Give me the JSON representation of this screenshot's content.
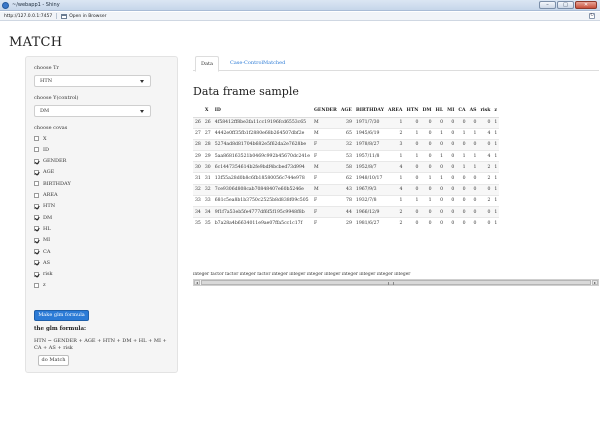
{
  "window": {
    "title": "~/webapp1 - Shiny",
    "buttons": [
      "–",
      "□",
      "✕"
    ]
  },
  "addressbar": {
    "url": "http://127.0.0.1:7457",
    "open_label": "Open in Browser",
    "refresh_glyph": "↻"
  },
  "app": {
    "title": "MATCH"
  },
  "sidebar": {
    "tr_label": "choose Tr",
    "tr_value": "HTN",
    "y_label": "choose Y(control)",
    "y_value": "DM",
    "covas_label": "choose covas",
    "covas": [
      {
        "label": "X",
        "checked": false
      },
      {
        "label": "ID",
        "checked": false
      },
      {
        "label": "GENDER",
        "checked": true
      },
      {
        "label": "AGE",
        "checked": true
      },
      {
        "label": "BIRTHDAY",
        "checked": false
      },
      {
        "label": "AREA",
        "checked": false
      },
      {
        "label": "HTN",
        "checked": true
      },
      {
        "label": "DM",
        "checked": true
      },
      {
        "label": "HL",
        "checked": true
      },
      {
        "label": "MI",
        "checked": true
      },
      {
        "label": "CA",
        "checked": true
      },
      {
        "label": "AS",
        "checked": true
      },
      {
        "label": "risk",
        "checked": true
      },
      {
        "label": "z",
        "checked": false
      }
    ],
    "make_button": "Make glm formula",
    "glm_title": "the glm formula:",
    "glm_formula": "HTN ~ GENDER + AGE + HTN + DM + HL + MI + CA + AS + risk",
    "match_button": "do Match"
  },
  "tabs": [
    "Data",
    "Case-Control",
    "Matched"
  ],
  "main": {
    "section_title": "Data frame sample",
    "columns": [
      "",
      "X",
      "ID",
      "GENDER",
      "AGE",
      "BIRTHDAY",
      "AREA",
      "HTN",
      "DM",
      "HL",
      "MI",
      "CA",
      "AS",
      "risk",
      "z"
    ],
    "rows": [
      [
        "26",
        "26",
        "4f58412ff8be3fa11cc19196fcd6553c65",
        "M",
        "39",
        "1971/7/30",
        "1",
        "0",
        "0",
        "0",
        "0",
        "0",
        "0",
        "0",
        "1"
      ],
      [
        "27",
        "27",
        "4442e0ff35fb1f2880e68b264507dbf2e",
        "M",
        "65",
        "1945/6/19",
        "2",
        "1",
        "0",
        "1",
        "0",
        "1",
        "1",
        "4",
        "1"
      ],
      [
        "28",
        "28",
        "5274ad8d81704b682e5f62da2e7628be",
        "F",
        "32",
        "1978/8/27",
        "3",
        "0",
        "0",
        "0",
        "0",
        "0",
        "0",
        "0",
        "1"
      ],
      [
        "29",
        "29",
        "5aa868163521b0469c992b45670dc241e",
        "F",
        "53",
        "1957/11/8",
        "1",
        "1",
        "0",
        "1",
        "0",
        "1",
        "1",
        "4",
        "1"
      ],
      [
        "30",
        "30",
        "6c1447354614b2fe9bdf4bcbed73d994",
        "M",
        "58",
        "1952/8/7",
        "4",
        "0",
        "0",
        "0",
        "0",
        "1",
        "1",
        "2",
        "1"
      ],
      [
        "31",
        "31",
        "13f55a28d0b8c6fb18580056c744e978",
        "F",
        "62",
        "1948/10/17",
        "1",
        "0",
        "1",
        "1",
        "0",
        "0",
        "0",
        "2",
        "1"
      ],
      [
        "32",
        "32",
        "7ce9306d808cab70848407e60b5246e",
        "M",
        "43",
        "1967/9/3",
        "4",
        "0",
        "0",
        "0",
        "0",
        "0",
        "0",
        "0",
        "1"
      ],
      [
        "33",
        "33",
        "681c5ea8b1b3750c2525b8d838f09c505",
        "F",
        "78",
        "1932/7/8",
        "1",
        "1",
        "1",
        "0",
        "0",
        "0",
        "0",
        "2",
        "1"
      ],
      [
        "34",
        "34",
        "9f1f7a53eb5fe4777df6f5f195c9948f8b",
        "F",
        "44",
        "1966/12/9",
        "2",
        "0",
        "0",
        "0",
        "0",
        "0",
        "0",
        "0",
        "1"
      ],
      [
        "35",
        "35",
        "b7a28a4b6634011e9ae07ffa5cc1c17f",
        "F",
        "29",
        "1981/6/27",
        "2",
        "0",
        "0",
        "0",
        "0",
        "0",
        "0",
        "0",
        "1"
      ]
    ],
    "types": "integer factor factor integer factor integer integer integer integer integer integer integer integer"
  }
}
